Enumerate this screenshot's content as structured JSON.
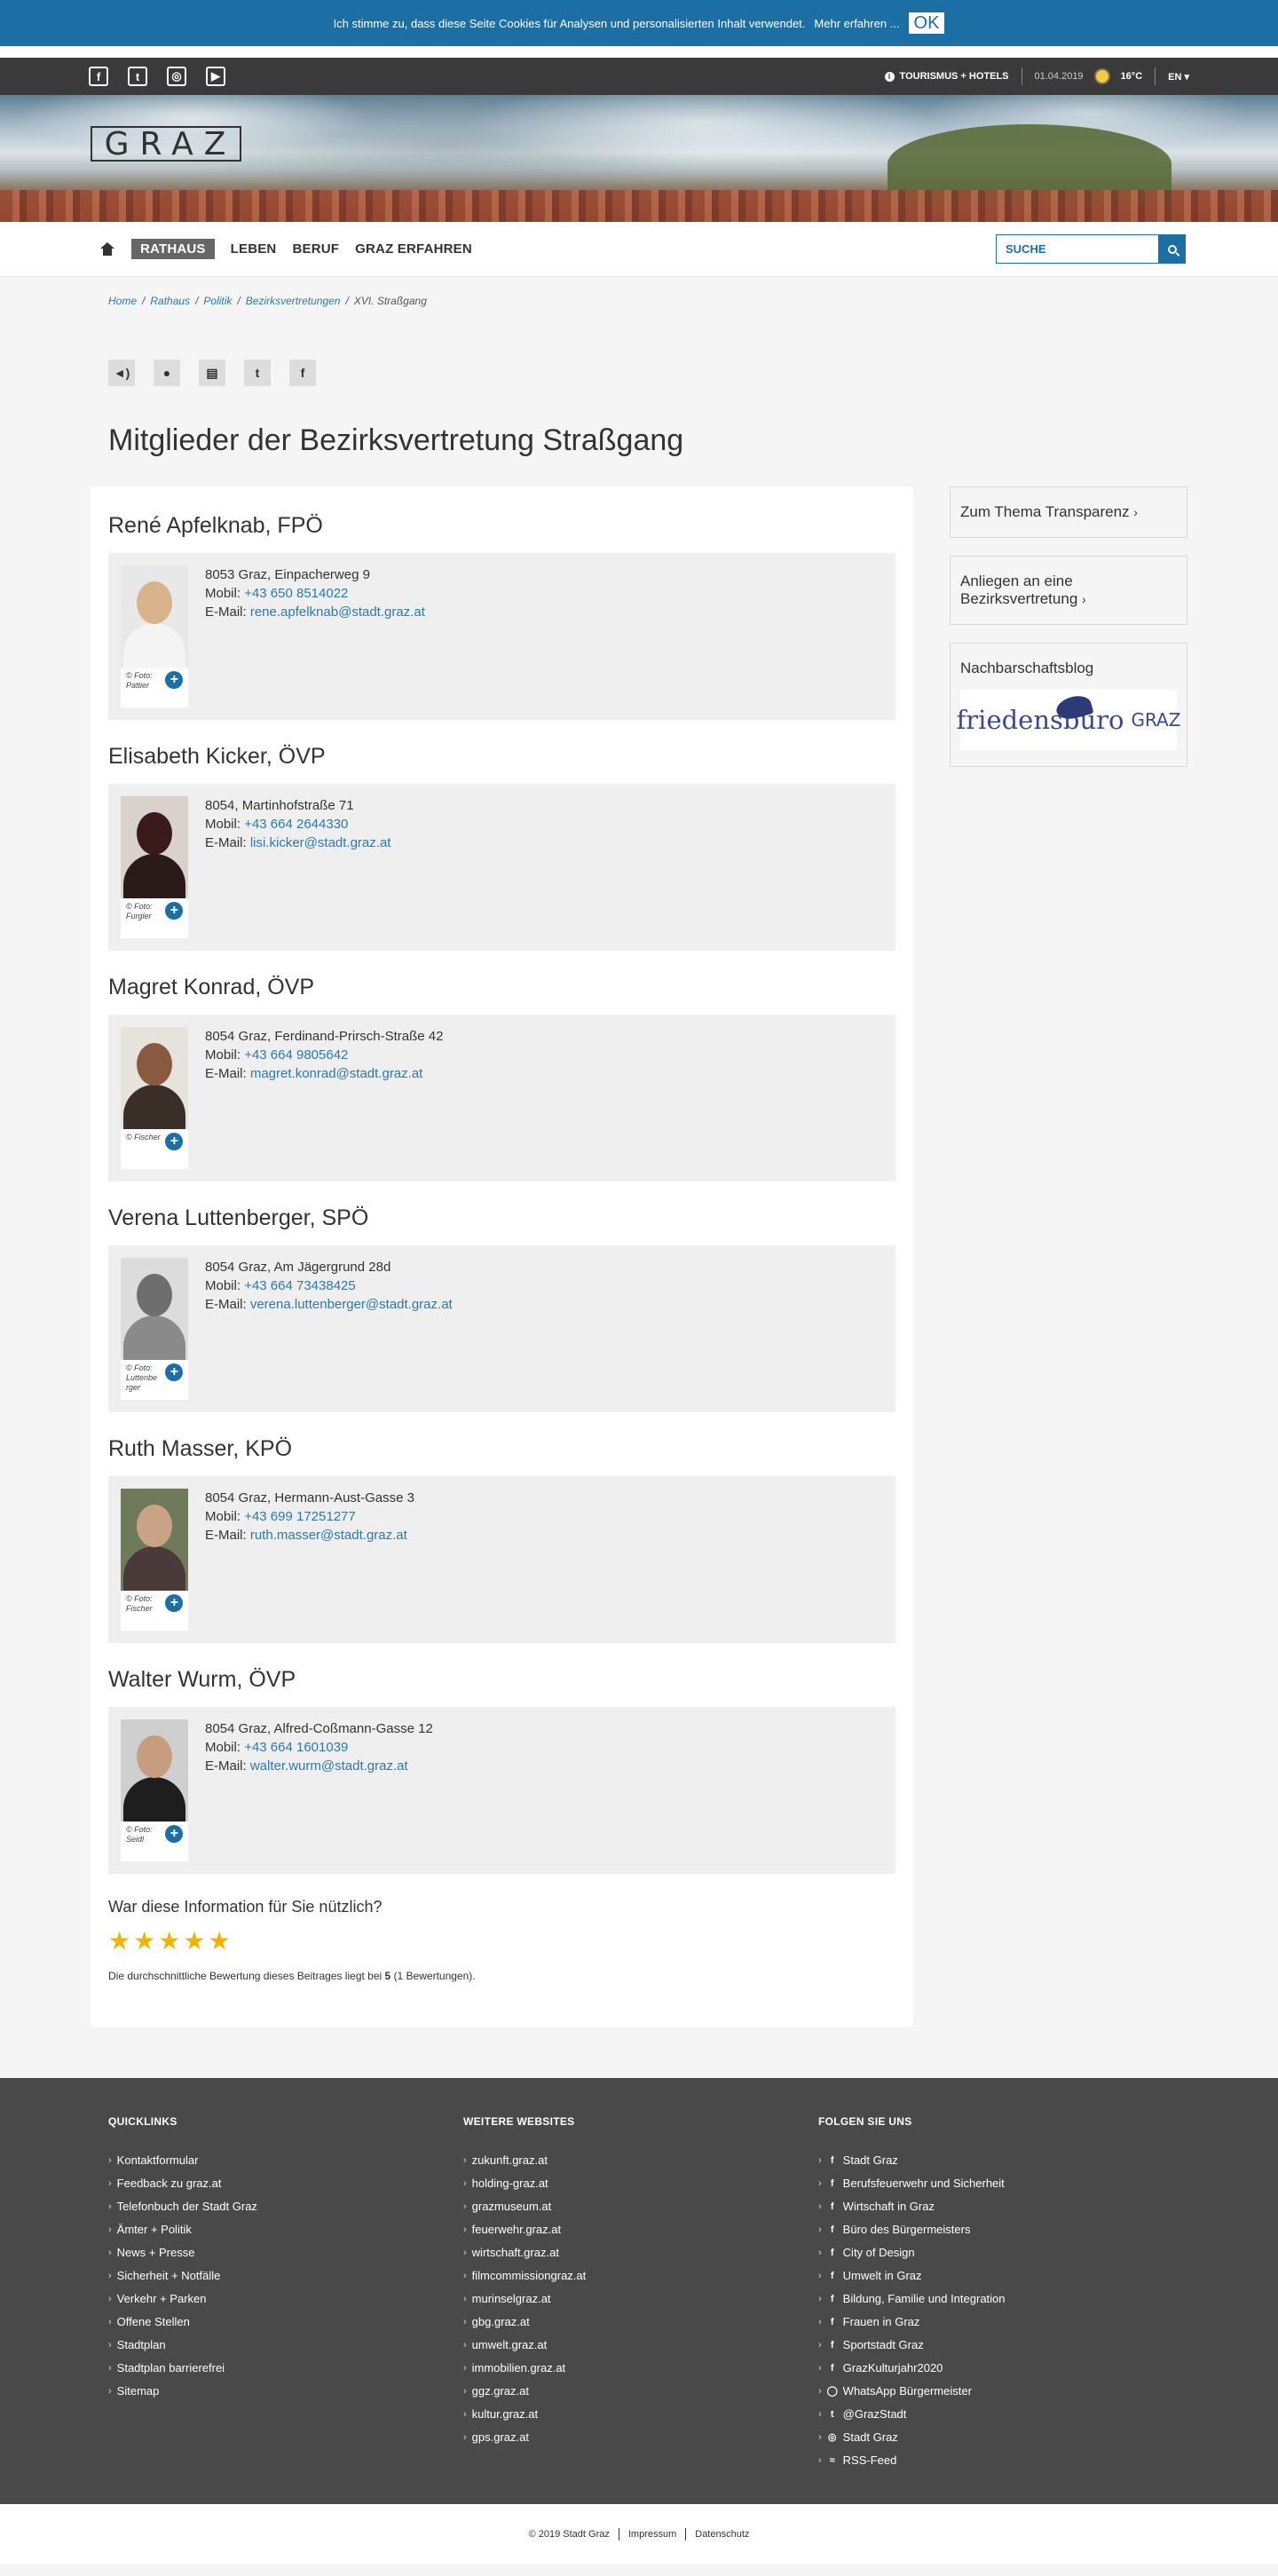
{
  "cookie": {
    "text": "Ich stimme zu, dass diese Seite Cookies für Analysen und personalisierten Inhalt verwendet.",
    "more": "Mehr erfahren ...",
    "ok": "OK"
  },
  "topbar": {
    "social": [
      {
        "icon": "facebook-icon",
        "glyph": "f"
      },
      {
        "icon": "twitter-icon",
        "glyph": "t"
      },
      {
        "icon": "instagram-icon",
        "glyph": "◎"
      },
      {
        "icon": "youtube-icon",
        "glyph": "▶"
      }
    ],
    "tourism": "TOURISMUS + HOTELS",
    "date": "01.04.2019",
    "temperature": "16°C",
    "language": "EN ▾"
  },
  "logo": "GRAZ",
  "nav": {
    "items": [
      "RATHAUS",
      "LEBEN",
      "BERUF",
      "GRAZ ERFAHREN"
    ],
    "search_placeholder": "SUCHE"
  },
  "breadcrumb": [
    "Home",
    "Rathaus",
    "Politik",
    "Bezirksvertretungen",
    "XVI. Straßgang"
  ],
  "page_title": "Mitglieder der Bezirksvertretung Straßgang",
  "members": [
    {
      "name": "René Apfelknab, FPÖ",
      "caption": "© Foto: Pattier",
      "address": "8053 Graz, Einpacherweg 9",
      "mobile": "+43 650 8514022",
      "email": "rene.apfelknab@stadt.graz.at"
    },
    {
      "name": "Elisabeth Kicker, ÖVP",
      "caption": "© Foto: Furgler",
      "address": "8054, Martinhofstraße 71",
      "mobile": "+43 664 2644330",
      "email": "lisi.kicker@stadt.graz.at"
    },
    {
      "name": "Magret Konrad, ÖVP",
      "caption": "© Fischer",
      "address": "8054 Graz, Ferdinand-Prirsch-Straße 42",
      "mobile": "+43 664 9805642",
      "email": "magret.konrad@stadt.graz.at"
    },
    {
      "name": "Verena Luttenberger, SPÖ",
      "caption": "© Foto: Luttenbe rger",
      "address": "8054 Graz, Am Jägergrund 28d",
      "mobile": "+43 664 73438425",
      "email": "verena.luttenberger@stadt.graz.at"
    },
    {
      "name": "Ruth Masser, KPÖ",
      "caption": "© Foto: Fischer",
      "address": "8054 Graz, Hermann-Aust-Gasse 3",
      "mobile": "+43 699 17251277",
      "email": "ruth.masser@stadt.graz.at"
    },
    {
      "name": "Walter Wurm, ÖVP",
      "caption": "© Foto: Seidl",
      "address": "8054 Graz, Alfred-Coßmann-Gasse 12",
      "mobile": "+43 664 1601039",
      "email": "walter.wurm@stadt.graz.at"
    }
  ],
  "labels": {
    "mobile": "Mobil:",
    "email": "E-Mail:"
  },
  "rating": {
    "question": "War diese Information für Sie nützlich?",
    "stars": 5,
    "avg_pre": "Die durchschnittliche Bewertung dieses Beitrages liegt bei",
    "avg_value": "5",
    "avg_post": "(1 Bewertungen)."
  },
  "sidebar": {
    "transparenz": "Zum Thema Transparenz",
    "anliegen": "Anliegen an eine Bezirksvertretung",
    "blog_title": "Nachbarschaftsblog",
    "blog_logo": "friedensbüro",
    "blog_logo_graz": "GRAZ"
  },
  "footer": {
    "quicklinks": {
      "title": "QUICKLINKS",
      "items": [
        "Kontaktformular",
        "Feedback zu graz.at",
        "Telefonbuch der Stadt Graz",
        "Ämter + Politik",
        "News + Presse",
        "Sicherheit + Notfälle",
        "Verkehr + Parken",
        "Offene Stellen",
        "Stadtplan",
        "Stadtplan barrierefrei",
        "Sitemap"
      ]
    },
    "websites": {
      "title": "WEITERE WEBSITES",
      "items": [
        "zukunft.graz.at",
        "holding-graz.at",
        "grazmuseum.at",
        "feuerwehr.graz.at",
        "wirtschaft.graz.at",
        "filmcommissiongraz.at",
        "murinselgraz.at",
        "gbg.graz.at",
        "umwelt.graz.at",
        "immobilien.graz.at",
        "ggz.graz.at",
        "kultur.graz.at",
        "gps.graz.at"
      ]
    },
    "follow": {
      "title": "FOLGEN SIE UNS",
      "items": [
        {
          "label": "Stadt Graz",
          "icon": "facebook-icon",
          "glyph": "f"
        },
        {
          "label": "Berufsfeuerwehr und Sicherheit",
          "icon": "facebook-icon",
          "glyph": "f"
        },
        {
          "label": "Wirtschaft in Graz",
          "icon": "facebook-icon",
          "glyph": "f"
        },
        {
          "label": "Büro des Bürgermeisters",
          "icon": "facebook-icon",
          "glyph": "f"
        },
        {
          "label": "City of Design",
          "icon": "facebook-icon",
          "glyph": "f"
        },
        {
          "label": "Umwelt in Graz",
          "icon": "facebook-icon",
          "glyph": "f"
        },
        {
          "label": "Bildung, Familie und Integration",
          "icon": "facebook-icon",
          "glyph": "f"
        },
        {
          "label": "Frauen in Graz",
          "icon": "facebook-icon",
          "glyph": "f"
        },
        {
          "label": "Sportstadt Graz",
          "icon": "facebook-icon",
          "glyph": "f"
        },
        {
          "label": "GrazKulturjahr2020",
          "icon": "facebook-icon",
          "glyph": "f"
        },
        {
          "label": "WhatsApp Bürgermeister",
          "icon": "whatsapp-icon",
          "glyph": "◯"
        },
        {
          "label": "@GrazStadt",
          "icon": "twitter-icon",
          "glyph": "t"
        },
        {
          "label": "Stadt Graz",
          "icon": "instagram-icon",
          "glyph": "◎"
        },
        {
          "label": "RSS-Feed",
          "icon": "rss-icon",
          "glyph": "≈"
        }
      ]
    }
  },
  "bottom": {
    "copyright": "© 2019 Stadt Graz",
    "impressum": "Impressum",
    "datenschutz": "Datenschutz"
  }
}
